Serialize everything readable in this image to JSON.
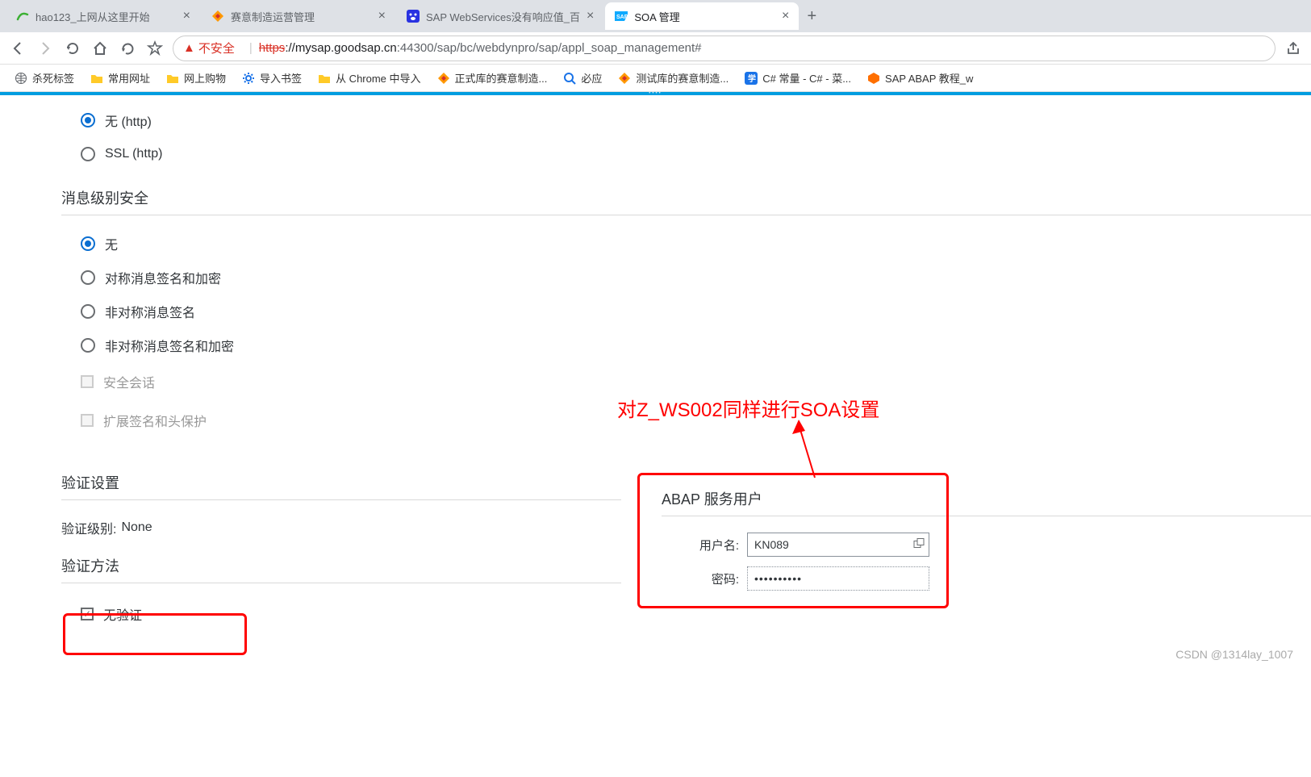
{
  "tabs": [
    {
      "title": "hao123_上网从这里开始",
      "active": false
    },
    {
      "title": "赛意制造运营管理",
      "active": false
    },
    {
      "title": "SAP WebServices没有响应值_百",
      "active": false
    },
    {
      "title": "SOA 管理",
      "active": true
    }
  ],
  "address": {
    "insecure_label": "不安全",
    "protocol": "https",
    "host": "://mysap.goodsap.cn",
    "port_path": ":44300/sap/bc/webdynpro/sap/appl_soap_management#"
  },
  "bookmarks": [
    {
      "label": "杀死标签"
    },
    {
      "label": "常用网址"
    },
    {
      "label": "网上购物"
    },
    {
      "label": "导入书签"
    },
    {
      "label": "从 Chrome 中导入"
    },
    {
      "label": "正式库的赛意制造..."
    },
    {
      "label": "必应"
    },
    {
      "label": "测试库的赛意制造..."
    },
    {
      "label": "C# 常量 - C# - 菜..."
    },
    {
      "label": "SAP ABAP 教程_w"
    }
  ],
  "transport": {
    "opt_none": "无 (http)",
    "opt_ssl": "SSL (http)"
  },
  "msg_sec": {
    "heading": "消息级别安全",
    "opt_none": "无",
    "opt_sym": "对称消息签名和加密",
    "opt_asym": "非对称消息签名",
    "opt_asym_enc": "非对称消息签名和加密",
    "chk_session": "安全会话",
    "chk_extsig": "扩展签名和头保护"
  },
  "auth": {
    "section": "验证设置",
    "level_label": "验证级别:",
    "level_value": "None",
    "method_heading": "验证方法",
    "none": "无验证"
  },
  "abap_user": {
    "heading": "ABAP 服务用户",
    "user_label": "用户名:",
    "user_value": "KN089",
    "pw_label": "密码:",
    "pw_value": "••••••••••"
  },
  "annotation_text": "对Z_WS002同样进行SOA设置",
  "watermark": "CSDN @1314lay_1007"
}
